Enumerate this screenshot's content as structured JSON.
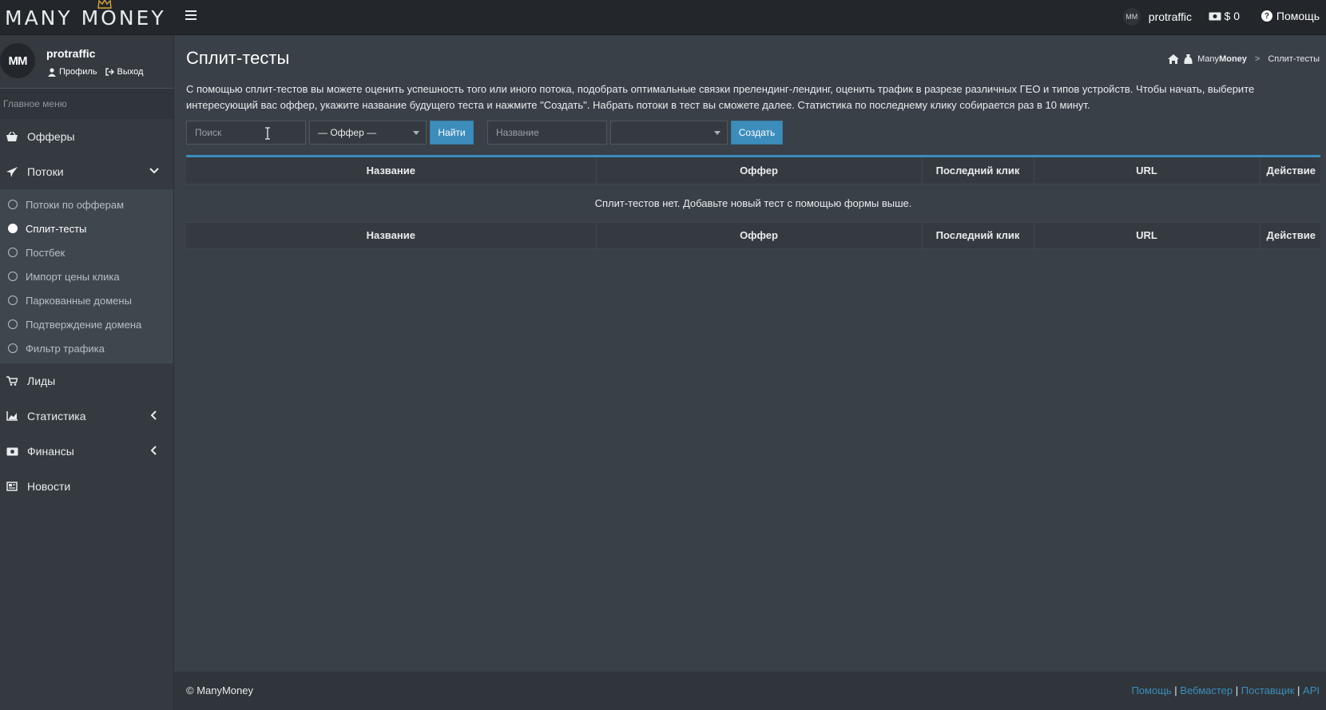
{
  "header": {
    "brand": "MANY MONEY",
    "user_name": "protraffic",
    "avatar_text": "MM",
    "balance": "$ 0",
    "help": "Помощь"
  },
  "sidebar": {
    "user_name": "protraffic",
    "avatar_text": "MM",
    "profile_link": "Профиль",
    "logout_link": "Выход",
    "menu_header": "Главное меню",
    "items": [
      {
        "label": "Офферы",
        "icon": "basket-icon"
      },
      {
        "label": "Потоки",
        "icon": "paper-plane-icon",
        "expanded": true
      },
      {
        "label": "Лиды",
        "icon": "cart-icon"
      },
      {
        "label": "Статистика",
        "icon": "chart-icon"
      },
      {
        "label": "Финансы",
        "icon": "money-icon"
      },
      {
        "label": "Новости",
        "icon": "newspaper-icon"
      }
    ],
    "subitems": [
      {
        "label": "Потоки по офферам",
        "active": false
      },
      {
        "label": "Сплит-тесты",
        "active": true
      },
      {
        "label": "Постбек",
        "active": false
      },
      {
        "label": "Импорт цены клика",
        "active": false
      },
      {
        "label": "Паркованные домены",
        "active": false
      },
      {
        "label": "Подтверждение домена",
        "active": false
      },
      {
        "label": "Фильтр трафика",
        "active": false
      }
    ]
  },
  "main": {
    "title": "Сплит-тесты",
    "breadcrumb": {
      "brand_plain": "Many",
      "brand_bold": "Money",
      "separator": ">",
      "current": "Сплит-тесты"
    },
    "intro": "С помощью сплит-тестов вы можете оценить успешность того или иного потока, подобрать оптимальные связки прелендинг-лендинг, оценить трафик в разрезе различных ГЕО и типов устройств. Чтобы начать, выберите интересующий вас оффер, укажите название будущего теста и нажмите \"Создать\". Набрать потоки в тест вы сможете далее. Статистика по последнему клику собирается раз в 10 минут.",
    "search_placeholder": "Поиск",
    "offer_select": "— Оффер —",
    "find_button": "Найти",
    "name_placeholder": "Название",
    "create_select": "",
    "create_button": "Создать",
    "table": {
      "columns": [
        "Название",
        "Оффер",
        "Последний клик",
        "URL",
        "Действие"
      ],
      "empty_message": "Сплит-тестов нет. Добавьте новый тест с помощью формы выше."
    }
  },
  "footer": {
    "copyright": "© ManyMoney",
    "links": [
      "Помощь",
      "Вебмастер",
      "Поставщик",
      "API"
    ]
  },
  "colors": {
    "accent": "#3c8dbc",
    "topbar": "#23272b",
    "sidebar": "#343a40",
    "content": "#3a4047"
  }
}
